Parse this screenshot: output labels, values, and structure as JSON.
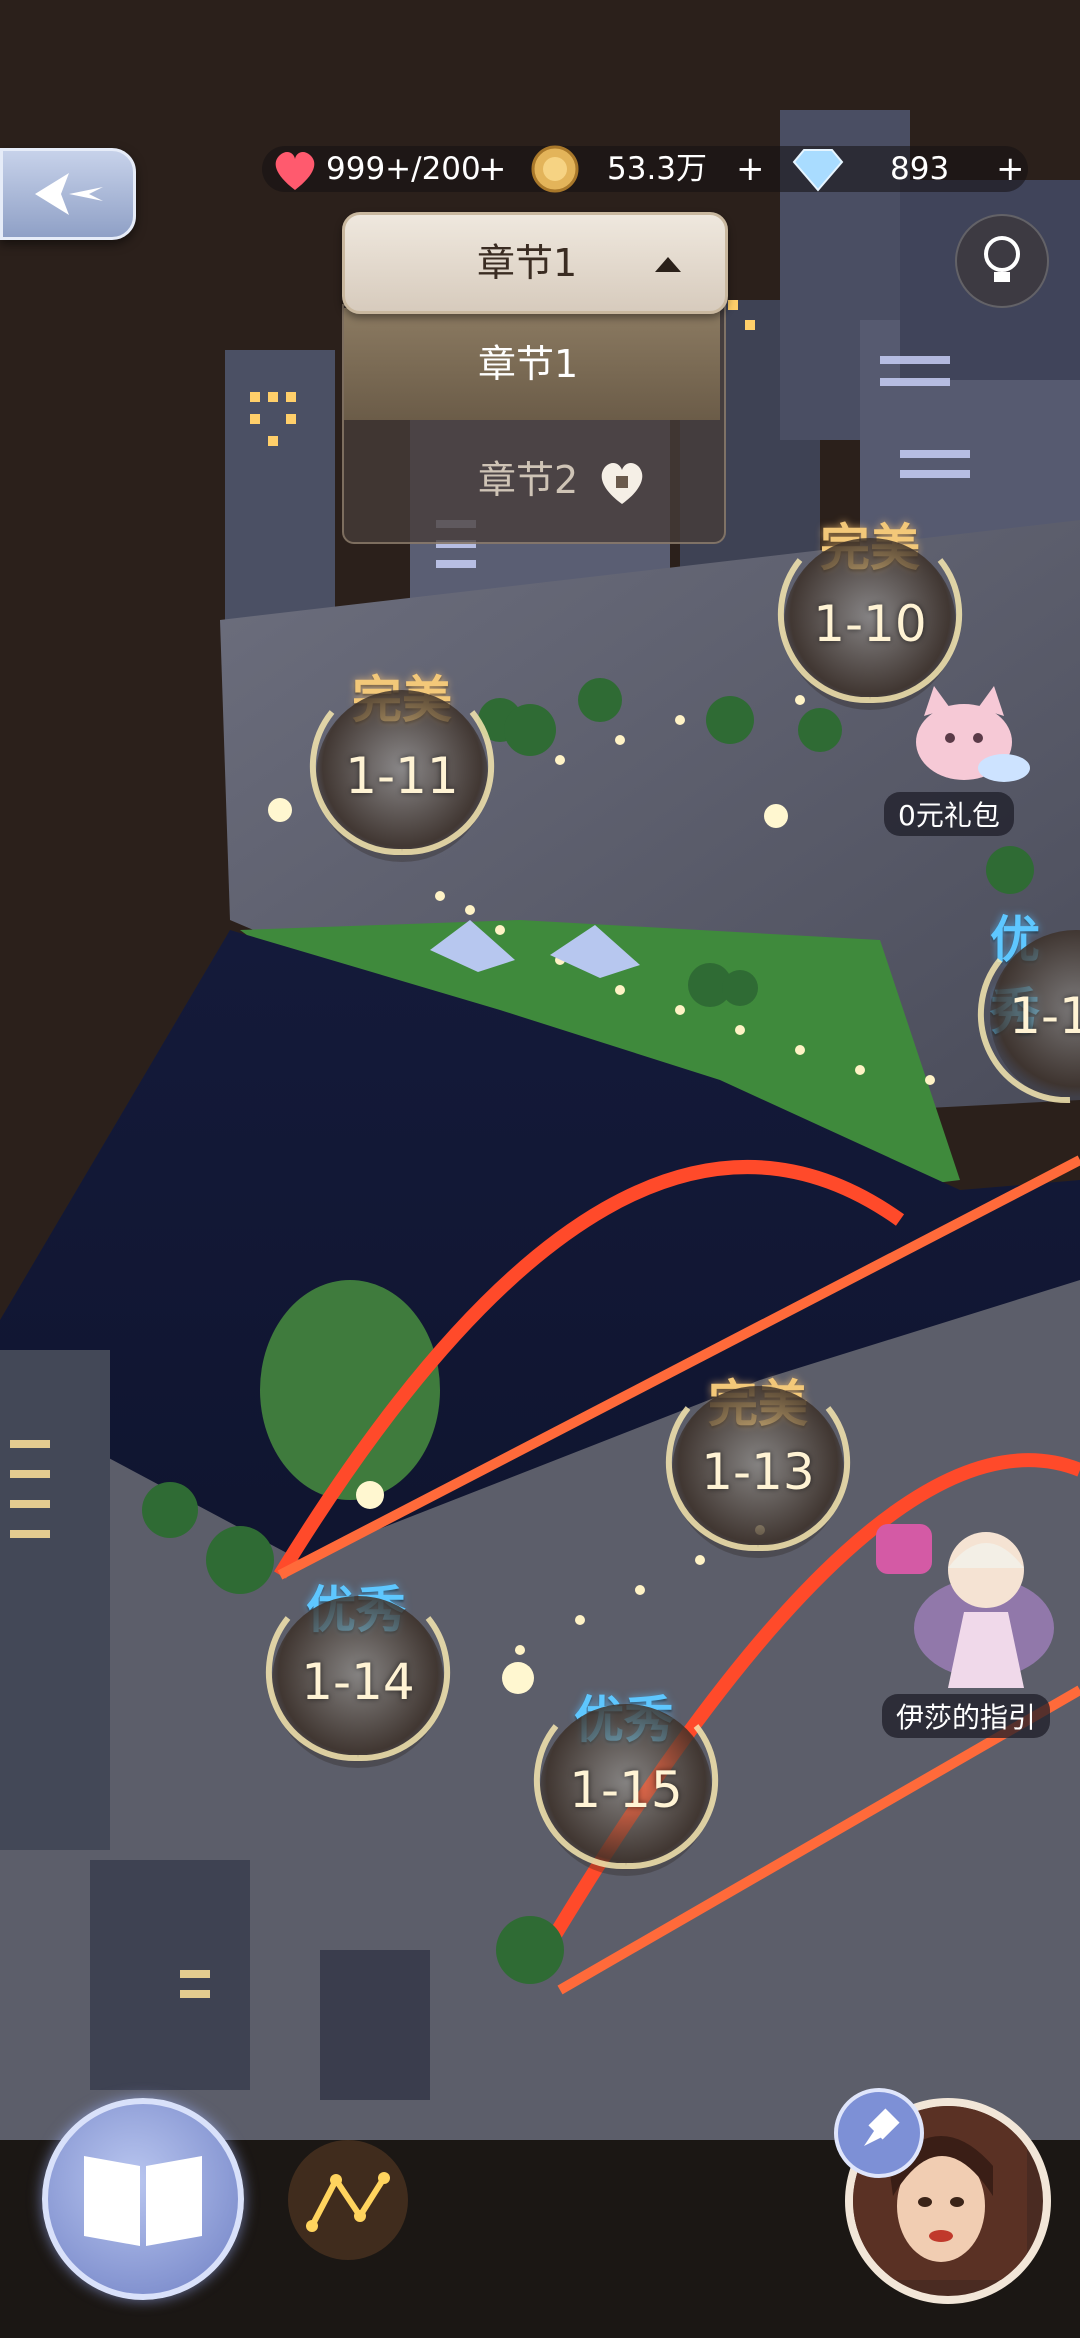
{
  "resources": {
    "stamina": "999+/200",
    "coins": "53.3万",
    "diamonds": "893",
    "plus": "+"
  },
  "chapter_dropdown": {
    "selected": "章节1",
    "options": [
      {
        "label": "章节1",
        "locked": false
      },
      {
        "label": "章节2",
        "locked": true
      }
    ]
  },
  "levels": [
    {
      "id": "1-10",
      "rank": "完美"
    },
    {
      "id": "1-11",
      "rank": "完美"
    },
    {
      "id": "1-1",
      "rank": "优秀"
    },
    {
      "id": "1-13",
      "rank": "完美"
    },
    {
      "id": "1-14",
      "rank": "优秀"
    },
    {
      "id": "1-15",
      "rank": "优秀"
    }
  ],
  "gift_label": "0元礼包",
  "guide_label": "伊莎的指引",
  "colors": {
    "perfect": "#f3c879",
    "excellent": "#5ec7ff",
    "bridge": "#ff4a2a"
  },
  "icons": [
    "back-icon",
    "heart-icon",
    "coin-icon",
    "diamond-icon",
    "lightbulb-icon",
    "lock-icon",
    "laurel-icon",
    "book-icon",
    "path-icon",
    "pin-icon"
  ]
}
